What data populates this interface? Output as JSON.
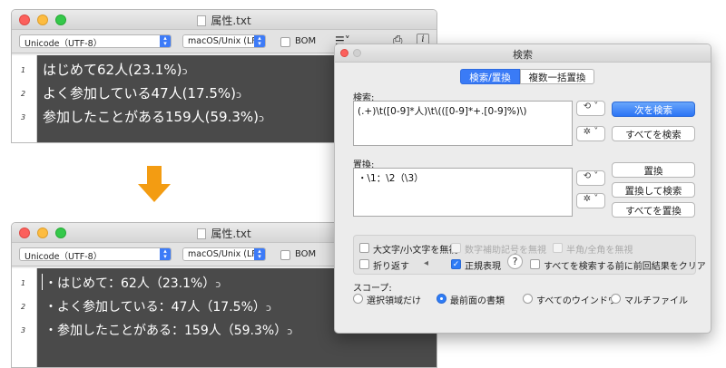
{
  "top_window": {
    "title": "属性.txt",
    "encoding": "Unicode（UTF-8）",
    "line_ending": "macOS/Unix (LF)",
    "bom_label": "BOM",
    "line_numbers": [
      "1",
      "2",
      "3"
    ],
    "lines": [
      "はじめて62人(23.1%)",
      "よく参加している47人(17.5%)",
      "参加したことがある159人(59.3%)"
    ],
    "line_end_mark": "ↄ"
  },
  "bottom_window": {
    "title": "属性.txt",
    "encoding": "Unicode（UTF-8）",
    "line_ending": "macOS/Unix (LF)",
    "bom_label": "BOM",
    "line_numbers": [
      "1",
      "2",
      "3"
    ],
    "lines": [
      "・はじめて：62人（23.1%）",
      "・よく参加している：47人（17.5%）",
      "・参加したことがある：159人（59.3%）"
    ],
    "line_end_mark": "ↄ"
  },
  "arrow": {
    "color": "#f39c12",
    "icon": "arrow-down-icon"
  },
  "find_panel": {
    "title": "検索",
    "tabs": [
      "検索/置換",
      "複数一括置換"
    ],
    "search_label": "検索:",
    "search_value": "(.+)\\t([0-9]*人)\\t\\(([0-9]*+.[0-9]%)\\)",
    "replace_label": "置換:",
    "replace_value": "・\\1：\\2（\\3）",
    "buttons": {
      "find_next": "次を検索",
      "find_all": "すべてを検索",
      "replace": "置換",
      "replace_and_find": "置換して検索",
      "replace_all": "すべてを置換"
    },
    "options": {
      "case": "大文字/小文字を無視",
      "unicode_mark": "数字補助記号を無視",
      "width": "半角/全角を無視",
      "wrap": "折り返す",
      "regex": "正規表現",
      "help": "?",
      "clear_before": "すべてを検索する前に前回結果をクリア"
    },
    "scope_label": "スコープ:",
    "scopes": [
      "選択領域だけ",
      "最前面の書類",
      "すべてのウインドウ",
      "マルチファイル"
    ],
    "selected_scope": "最前面の書類",
    "accent": "#3a7bf6"
  }
}
